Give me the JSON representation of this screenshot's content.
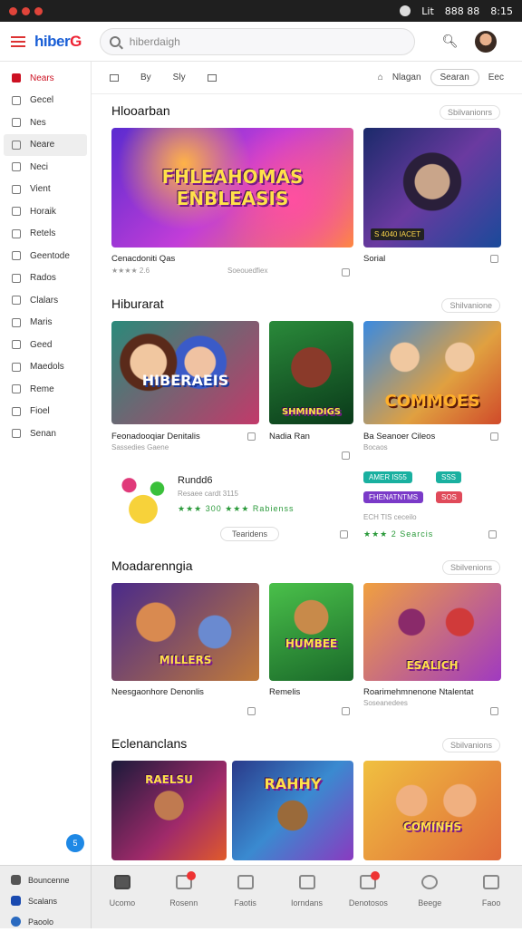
{
  "status": {
    "time": "8:15",
    "indicators": "888 88",
    "net": "Lit"
  },
  "header": {
    "logo_main": "hiber",
    "logo_accent": "G",
    "search_placeholder": "hiberdaigh"
  },
  "sidebar": {
    "items": [
      {
        "label": "Nears"
      },
      {
        "label": "Gecel"
      },
      {
        "label": "Nes"
      },
      {
        "label": "Neare"
      },
      {
        "label": "Neci"
      },
      {
        "label": "Vient"
      },
      {
        "label": "Horaik"
      },
      {
        "label": "Retels"
      },
      {
        "label": "Geentode"
      },
      {
        "label": "Rados"
      },
      {
        "label": "Clalars"
      },
      {
        "label": "Maris"
      },
      {
        "label": "Geed"
      },
      {
        "label": "Maedols"
      },
      {
        "label": "Reme"
      },
      {
        "label": "Fioel"
      },
      {
        "label": "Senan"
      }
    ],
    "fab_label": "5"
  },
  "filters": {
    "f1": "By",
    "f2": "Sly",
    "right_label": "Nlagan",
    "pill": "Searan",
    "end": "Eec"
  },
  "sections": [
    {
      "title": "Hlooarban",
      "see_all": "Sbilvanionrs"
    },
    {
      "title": "Hiburarat",
      "see_all": "Shilvanione"
    },
    {
      "title": "Moadarenngia",
      "see_all": "Sbilvenions"
    },
    {
      "title": "Eclenanclans",
      "see_all": "Sbilvanions"
    }
  ],
  "cards": {
    "c1": {
      "art": "FHLEAHOMAS ENBLEASIS",
      "caption": "Cenacdoniti Qas",
      "sub": "★★★★ 2.6",
      "extra": "Soeouedfiex"
    },
    "c2": {
      "art": "",
      "caption": "Sorial",
      "sub": "",
      "badge": "S 4040 IACET"
    },
    "c3": {
      "art": "HIBERAEIS",
      "caption": "Feonadooqiar Denitalis",
      "sub": "Sassedies Gaene"
    },
    "c4": {
      "art": "SHMINDIGS",
      "caption": "Nadia Ran",
      "sub": ""
    },
    "c5": {
      "art": "COMMOES",
      "caption": "Ba Seanoer Cileos",
      "sub": "Bocaos"
    },
    "c6": {
      "title": "Rundd6",
      "sub": "Resaee cardt 3115",
      "rating": "★★★ 300 ★★★ Rabienss",
      "button": "Tearidens"
    },
    "c7": {
      "tag1": "AMER IS55",
      "tag2": "SSS",
      "tag3": "FHENATNTMS",
      "tag4": "SOS",
      "line1": "ECH TIS ceceilo",
      "rating": "★★★ 2 Searcis"
    },
    "c8": {
      "art": "MILLERS",
      "caption": "Neesgaonhore Denonlis",
      "sub": ""
    },
    "c9": {
      "art": "HUMBEE",
      "caption": "Remelis",
      "sub": ""
    },
    "c10": {
      "art": "ESALICH",
      "caption": "Roarimehmnenone Ntalentat",
      "sub": "Soseanedees"
    },
    "c11": {
      "art": "RAELSU",
      "caption": ""
    },
    "c12": {
      "art": "RAHHY",
      "caption": ""
    },
    "c13": {
      "art": "COMINHS",
      "caption": ""
    }
  },
  "bottom": {
    "left": [
      {
        "label": "Bouncenne"
      },
      {
        "label": "Scalans"
      },
      {
        "label": "Paoolo"
      }
    ],
    "tabs": [
      {
        "label": "Ucomo"
      },
      {
        "label": "Rosenn"
      },
      {
        "label": "Faotis"
      },
      {
        "label": "Iorndans"
      },
      {
        "label": "Denotosos"
      },
      {
        "label": "Beege"
      },
      {
        "label": "Faoo"
      }
    ]
  }
}
